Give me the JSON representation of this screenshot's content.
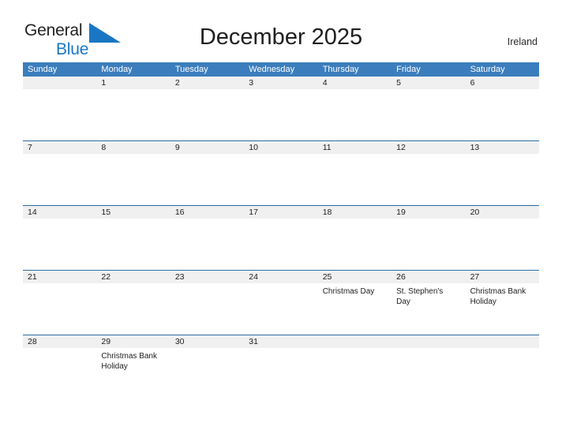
{
  "brand": {
    "name_line1": "General",
    "name_line2": "Blue",
    "triangle_color": "#1a76c4",
    "text_color": "#222222"
  },
  "header": {
    "title": "December 2025",
    "country": "Ireland"
  },
  "theme": {
    "header_blue": "#3b7dbd",
    "row_line_blue": "#2e6da4",
    "band_gray": "#f0f0f0",
    "text_color": "#1d1d1d"
  },
  "calendar": {
    "weekdays": [
      "Sunday",
      "Monday",
      "Tuesday",
      "Wednesday",
      "Thursday",
      "Friday",
      "Saturday"
    ],
    "weeks": [
      [
        {
          "day": "",
          "events": []
        },
        {
          "day": "1",
          "events": []
        },
        {
          "day": "2",
          "events": []
        },
        {
          "day": "3",
          "events": []
        },
        {
          "day": "4",
          "events": []
        },
        {
          "day": "5",
          "events": []
        },
        {
          "day": "6",
          "events": []
        }
      ],
      [
        {
          "day": "7",
          "events": []
        },
        {
          "day": "8",
          "events": []
        },
        {
          "day": "9",
          "events": []
        },
        {
          "day": "10",
          "events": []
        },
        {
          "day": "11",
          "events": []
        },
        {
          "day": "12",
          "events": []
        },
        {
          "day": "13",
          "events": []
        }
      ],
      [
        {
          "day": "14",
          "events": []
        },
        {
          "day": "15",
          "events": []
        },
        {
          "day": "16",
          "events": []
        },
        {
          "day": "17",
          "events": []
        },
        {
          "day": "18",
          "events": []
        },
        {
          "day": "19",
          "events": []
        },
        {
          "day": "20",
          "events": []
        }
      ],
      [
        {
          "day": "21",
          "events": []
        },
        {
          "day": "22",
          "events": []
        },
        {
          "day": "23",
          "events": []
        },
        {
          "day": "24",
          "events": []
        },
        {
          "day": "25",
          "events": [
            "Christmas Day"
          ]
        },
        {
          "day": "26",
          "events": [
            "St. Stephen's Day"
          ]
        },
        {
          "day": "27",
          "events": [
            "Christmas Bank Holiday"
          ]
        }
      ],
      [
        {
          "day": "28",
          "events": []
        },
        {
          "day": "29",
          "events": [
            "Christmas Bank Holiday"
          ]
        },
        {
          "day": "30",
          "events": []
        },
        {
          "day": "31",
          "events": []
        },
        {
          "day": "",
          "events": []
        },
        {
          "day": "",
          "events": []
        },
        {
          "day": "",
          "events": []
        }
      ]
    ]
  }
}
